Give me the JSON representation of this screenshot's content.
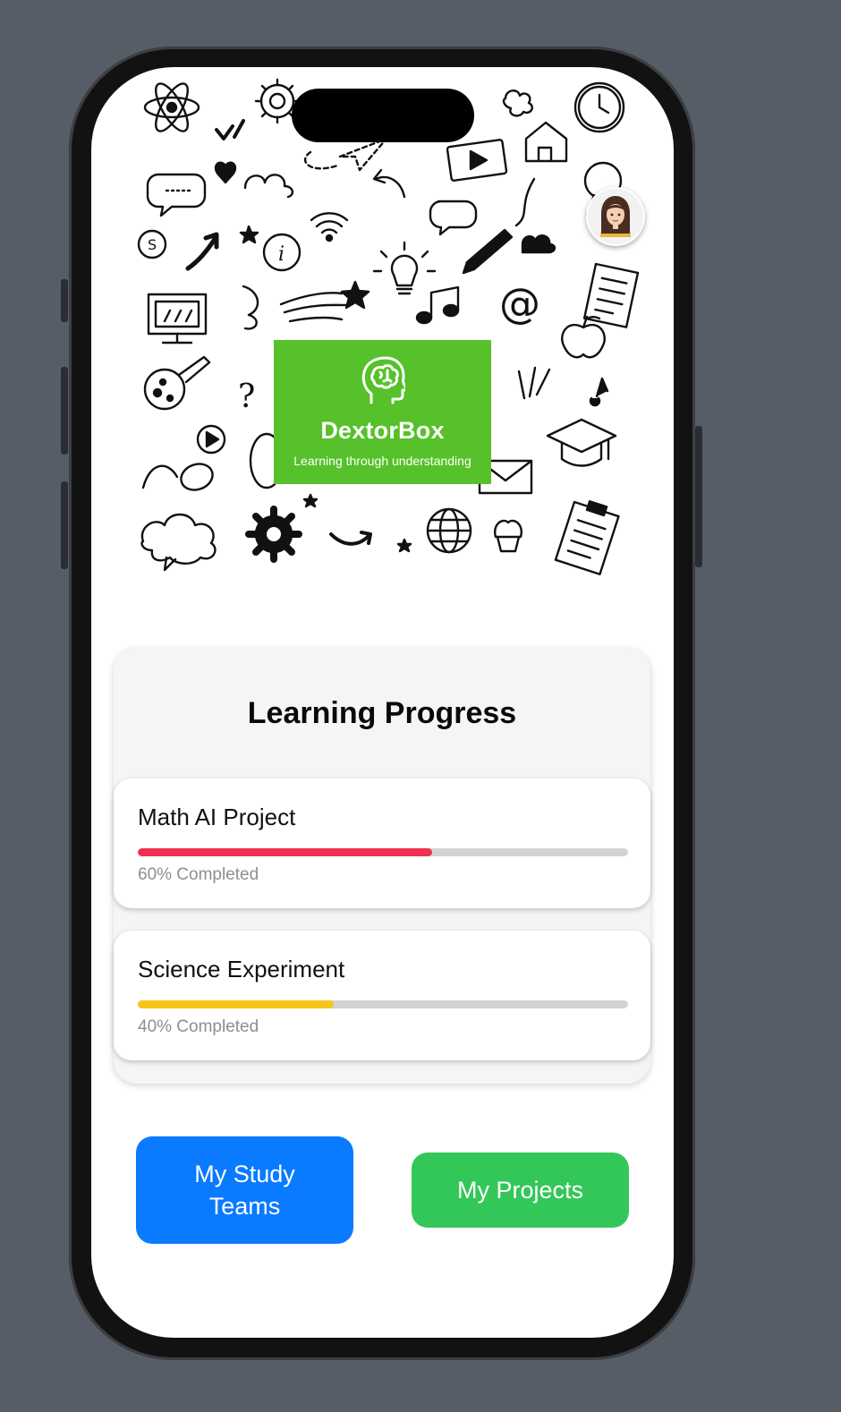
{
  "logo": {
    "title": "DextorBox",
    "subtitle": "Learning through understanding",
    "color": "#56c12a"
  },
  "avatar": {
    "icon": "user-avatar-icon"
  },
  "progress": {
    "title": "Learning Progress",
    "items": [
      {
        "name": "Math AI Project",
        "percent": 60,
        "status": "60% Completed",
        "color": "#f0304f"
      },
      {
        "name": "Science Experiment",
        "percent": 40,
        "status": "40% Completed",
        "color": "#f5c518"
      }
    ]
  },
  "buttons": {
    "study_teams": "My Study Teams",
    "study_teams_color": "#0a7aff",
    "projects": "My Projects",
    "projects_color": "#33c759"
  }
}
